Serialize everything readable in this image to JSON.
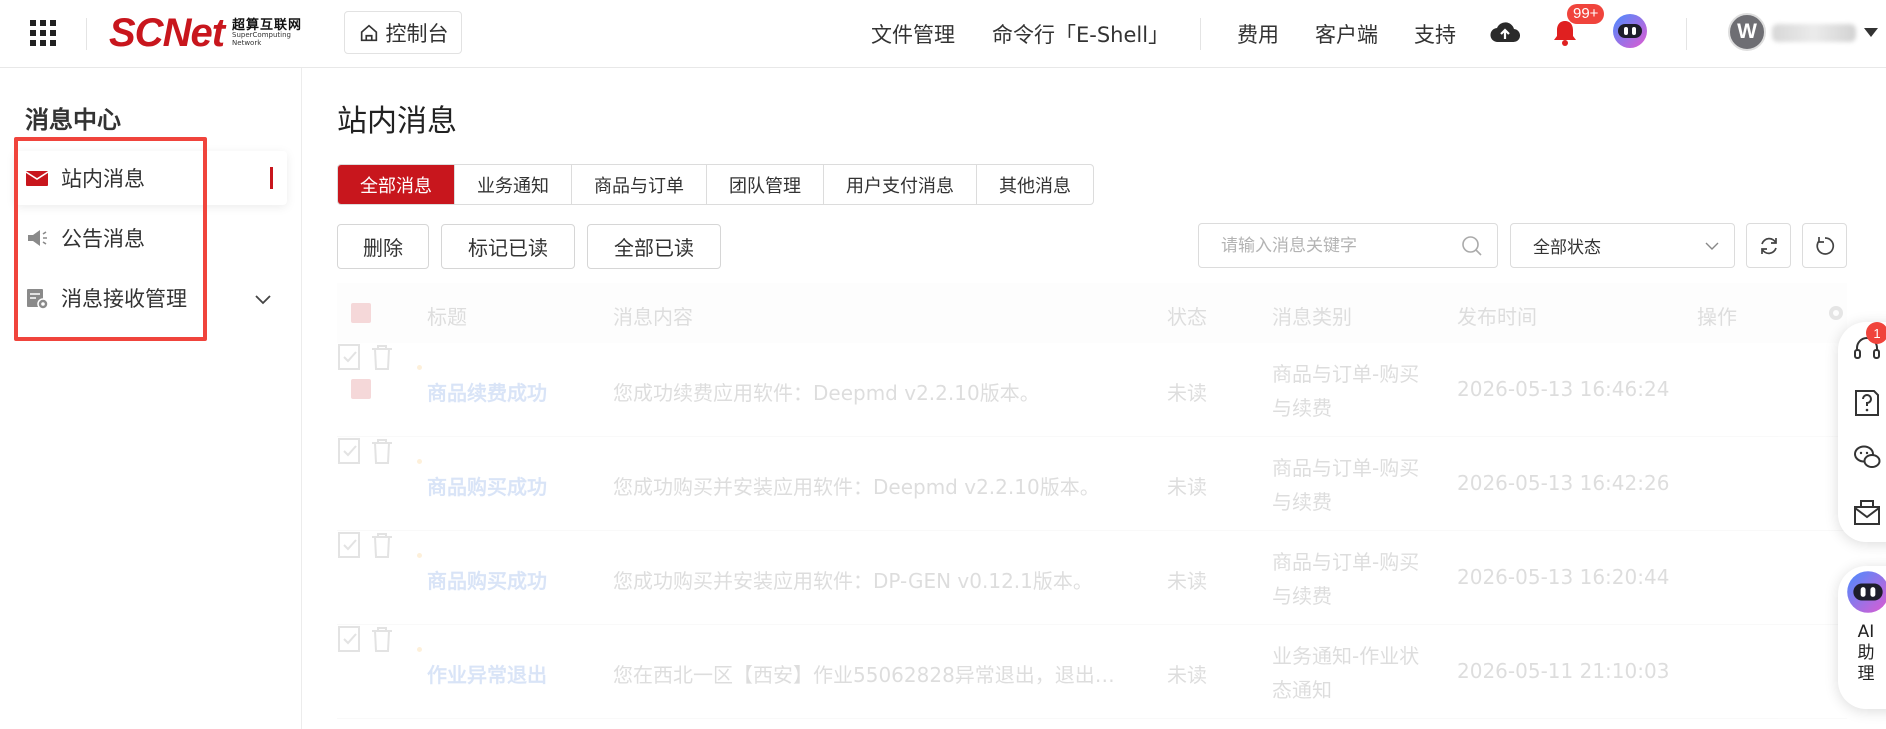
{
  "topbar": {
    "logo_mark": "SCNet",
    "logo_cn": "超算互联网",
    "logo_en_line1": "SuperComputing",
    "logo_en_line2": "Network",
    "console_label": "控制台",
    "nav": [
      "文件管理",
      "命令行「E-Shell」",
      "费用",
      "客户端",
      "支持"
    ],
    "notification_badge": "99+",
    "avatar_letter": "W"
  },
  "sidebar": {
    "title": "消息中心",
    "items": [
      {
        "label": "站内消息",
        "icon": "envelope-icon",
        "active": true
      },
      {
        "label": "公告消息",
        "icon": "megaphone-icon"
      },
      {
        "label": "消息接收管理",
        "icon": "settings-doc-icon",
        "expandable": true
      }
    ]
  },
  "main": {
    "title": "站内消息",
    "tabs": [
      "全部消息",
      "业务通知",
      "商品与订单",
      "团队管理",
      "用户支付消息",
      "其他消息"
    ],
    "active_tab": "全部消息",
    "buttons": {
      "delete": "删除",
      "mark_read": "标记已读",
      "all_read": "全部已读"
    },
    "search_placeholder": "请输入消息关键字",
    "status_select": "全部状态"
  },
  "table": {
    "columns": [
      "标题",
      "消息内容",
      "状态",
      "消息类别",
      "发布时间",
      "操作"
    ],
    "rows": [
      {
        "title": "商品续费成功",
        "content": "您成功续费应用软件：Deepmd v2.2.10版本。",
        "status": "未读",
        "type_line1": "商品与订单-购买",
        "type_line2": "与续费",
        "time": "2026-05-13 16:46:24",
        "checked": true
      },
      {
        "title": "商品购买成功",
        "content": "您成功购买并安装应用软件：Deepmd v2.2.10版本。",
        "status": "未读",
        "type_line1": "商品与订单-购买",
        "type_line2": "与续费",
        "time": "2026-05-13 16:42:26",
        "checked": false
      },
      {
        "title": "商品购买成功",
        "content": "您成功购买并安装应用软件：DP-GEN v0.12.1版本。",
        "status": "未读",
        "type_line1": "商品与订单-购买",
        "type_line2": "与续费",
        "time": "2026-05-13 16:20:44",
        "checked": false
      },
      {
        "title": "作业异常退出",
        "content": "您在西北一区【西安】作业55062828异常退出，退出…",
        "status": "未读",
        "type_line1": "业务通知-作业状",
        "type_line2": "态通知",
        "time": "2026-05-11 21:10:03",
        "checked": false
      }
    ]
  },
  "float_panel": {
    "service_badge": "1",
    "ai_label": "AI助理"
  },
  "colors": {
    "brand": "#c8161d",
    "highlight": "#f0443c"
  }
}
